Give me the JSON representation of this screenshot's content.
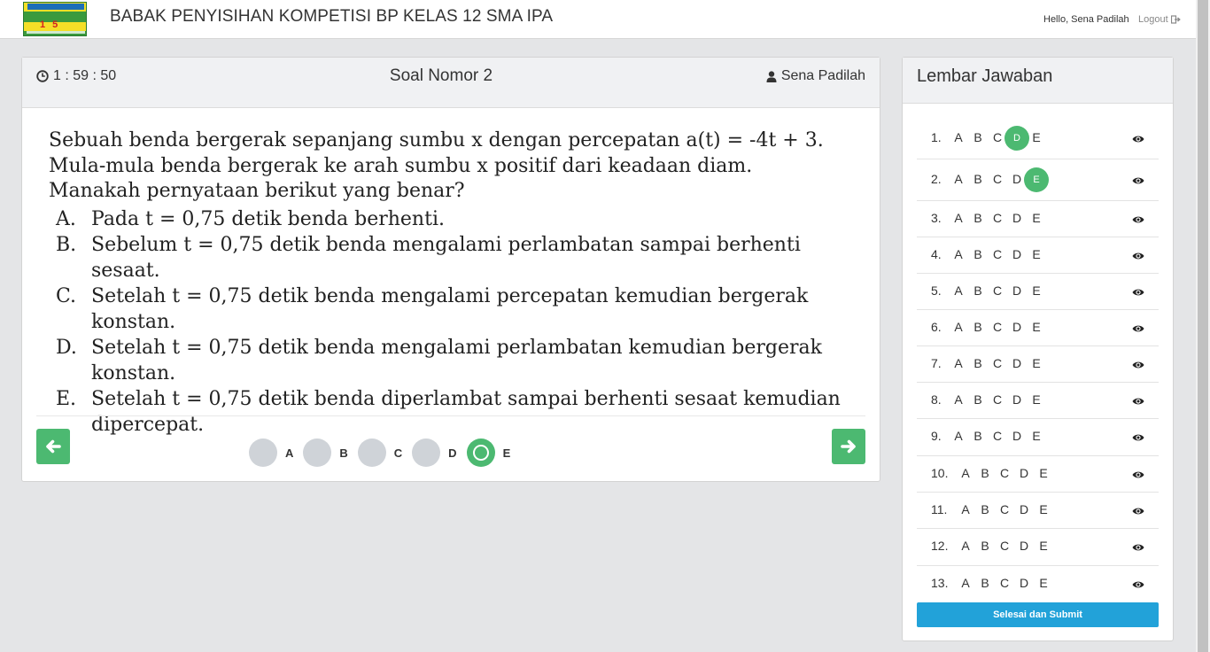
{
  "header": {
    "title": "BABAK PENYISIHAN KOMPETISI BP KELAS 12 SMA IPA",
    "greeting": "Hello, Sena Padilah",
    "logout_label": "Logout",
    "logo_text": "BINTANG PELAJAR 1 5"
  },
  "question_panel": {
    "timer": "1 : 59 : 50",
    "title": "Soal Nomor 2",
    "user": "Sena Padilah",
    "question_text": "Sebuah benda bergerak sepanjang sumbu x dengan percepatan a(t) = -4t + 3. Mula-mula benda bergerak ke arah sumbu x positif dari keadaan diam. Manakah pernyataan berikut yang benar?",
    "options": [
      {
        "letter": "A.",
        "text": "Pada  t = 0,75  detik benda berhenti."
      },
      {
        "letter": "B.",
        "text": "Sebelum  t = 0,75  detik benda mengalami perlambatan sampai berhenti sesaat."
      },
      {
        "letter": "C.",
        "text": "Setelah  t = 0,75  detik benda mengalami percepatan kemudian bergerak konstan."
      },
      {
        "letter": "D.",
        "text": "Setelah  t = 0,75  detik benda mengalami perlambatan kemudian bergerak konstan."
      },
      {
        "letter": "E.",
        "text": "Setelah  t = 0,75  detik benda diperlambat sampai berhenti sesaat kemudian dipercepat."
      }
    ],
    "answer_choices": [
      "A",
      "B",
      "C",
      "D",
      "E"
    ],
    "selected_answer": "E"
  },
  "answer_sheet": {
    "title": "Lembar Jawaban",
    "rows": [
      {
        "num": "1.",
        "selected": "D"
      },
      {
        "num": "2.",
        "selected": "E"
      },
      {
        "num": "3.",
        "selected": ""
      },
      {
        "num": "4.",
        "selected": ""
      },
      {
        "num": "5.",
        "selected": ""
      },
      {
        "num": "6.",
        "selected": ""
      },
      {
        "num": "7.",
        "selected": ""
      },
      {
        "num": "8.",
        "selected": ""
      },
      {
        "num": "9.",
        "selected": ""
      },
      {
        "num": "10.",
        "selected": ""
      },
      {
        "num": "11.",
        "selected": ""
      },
      {
        "num": "12.",
        "selected": ""
      },
      {
        "num": "13.",
        "selected": ""
      }
    ],
    "letters": [
      "A",
      "B",
      "C",
      "D",
      "E"
    ],
    "submit_label": "Selesai dan Submit"
  },
  "colors": {
    "accent_green": "#4cb971",
    "submit_blue": "#22a2d9",
    "unselected_circle": "#cfd3d8",
    "page_bg": "#e4e5e7"
  },
  "icons": {
    "timer": "clock-icon",
    "user": "user-icon",
    "logout": "logout-icon",
    "prev": "arrow-left-icon",
    "next": "arrow-right-icon",
    "view": "eye-icon"
  }
}
